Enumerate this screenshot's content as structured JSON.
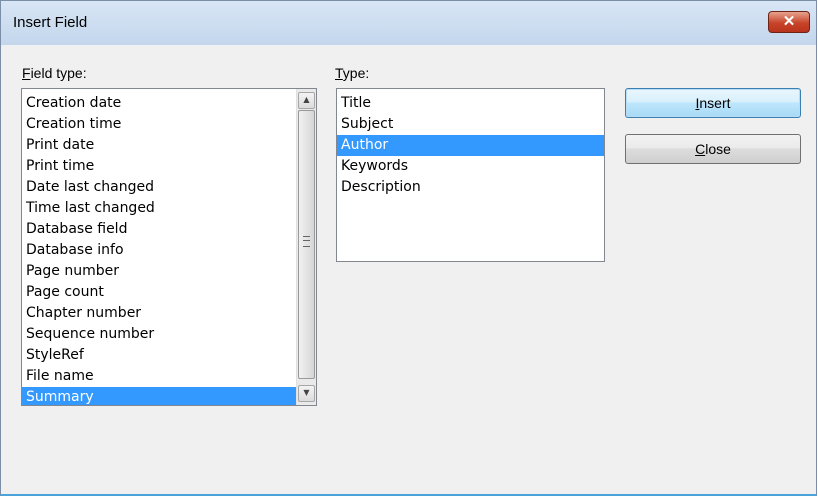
{
  "window": {
    "title": "Insert Field",
    "close_glyph": "✕"
  },
  "field_type": {
    "label_prefix": "",
    "label_mnemonic": "F",
    "label_rest": "ield type:",
    "items": [
      {
        "label": "Creation date"
      },
      {
        "label": "Creation time"
      },
      {
        "label": "Print date"
      },
      {
        "label": "Print time"
      },
      {
        "label": "Date last changed"
      },
      {
        "label": "Time last changed"
      },
      {
        "label": "Database field"
      },
      {
        "label": "Database info"
      },
      {
        "label": "Page number"
      },
      {
        "label": "Page count"
      },
      {
        "label": "Chapter number"
      },
      {
        "label": "Sequence number"
      },
      {
        "label": "StyleRef"
      },
      {
        "label": "File name"
      },
      {
        "label": "Summary",
        "selected": true
      }
    ],
    "scroll_up_glyph": "▲",
    "scroll_down_glyph": "▼"
  },
  "type": {
    "label_mnemonic": "T",
    "label_rest": "ype:",
    "items": [
      {
        "label": "Title"
      },
      {
        "label": "Subject"
      },
      {
        "label": "Author",
        "selected": true
      },
      {
        "label": "Keywords"
      },
      {
        "label": "Description"
      }
    ]
  },
  "buttons": {
    "insert": {
      "mnemonic": "I",
      "rest": "nsert"
    },
    "close": {
      "mnemonic": "C",
      "rest": "lose"
    }
  },
  "colors": {
    "selection": "#3399ff",
    "titlebar": "#c3d6ec",
    "close_button": "#c7442a"
  }
}
